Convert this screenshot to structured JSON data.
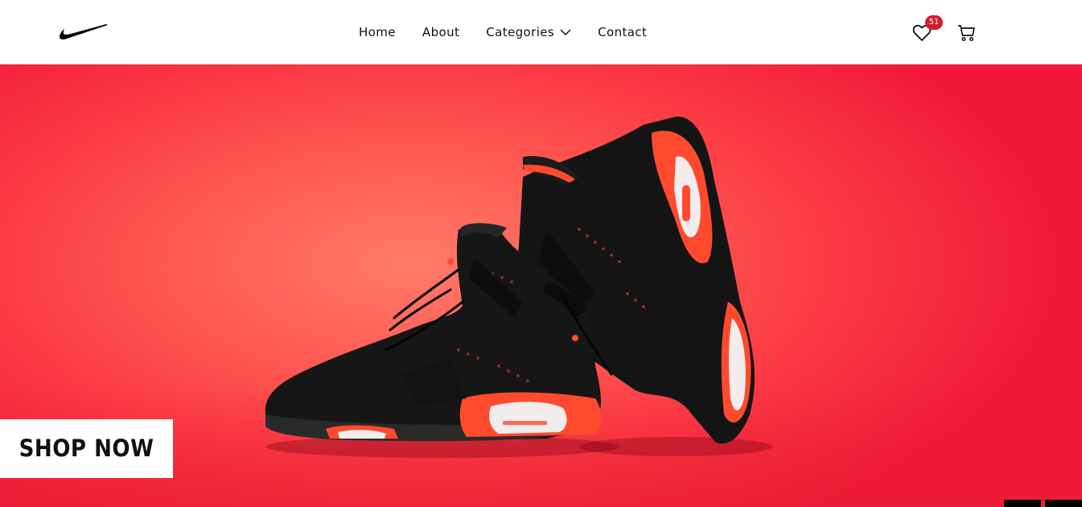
{
  "brand": {
    "logo_icon": "swoosh-logo"
  },
  "nav": {
    "home": "Home",
    "about": "About",
    "categories": "Categories",
    "contact": "Contact"
  },
  "icons": {
    "wishlist": "heart-icon",
    "cart": "cart-icon",
    "dropdown": "chevron-down-icon"
  },
  "wishlist": {
    "count": "51"
  },
  "hero": {
    "cta_label": "SHOP NOW"
  },
  "colors": {
    "hero_background": "#fb4a48",
    "badge": "#d81b2b",
    "shoe_accent": "#ff4a2e"
  }
}
